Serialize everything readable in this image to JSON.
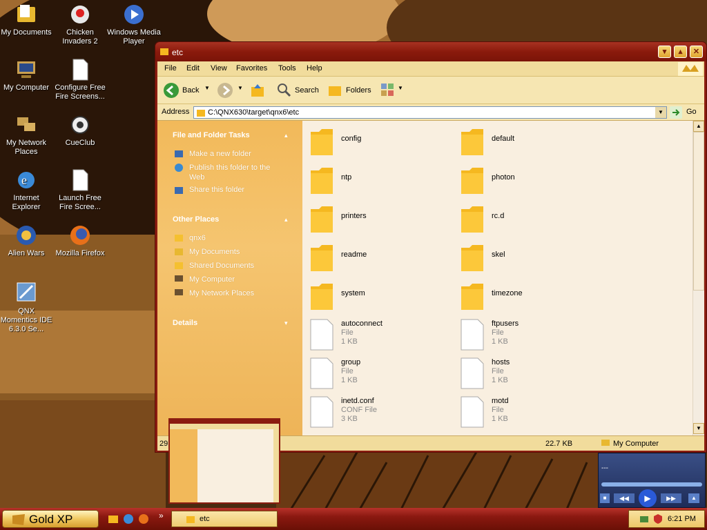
{
  "desktop": {
    "icons": [
      {
        "label": "My Documents"
      },
      {
        "label": "Chicken Invaders 2"
      },
      {
        "label": "Windows Media Player"
      },
      {
        "label": "My Computer"
      },
      {
        "label": "Configure Free Fire Screens..."
      },
      {
        "label": "My Network Places"
      },
      {
        "label": "CueClub"
      },
      {
        "label": "Internet Explorer"
      },
      {
        "label": "Launch Free Fire Scree..."
      },
      {
        "label": "Alien Wars"
      },
      {
        "label": "Mozilla Firefox"
      },
      {
        "label": "QNX Momentics IDE 6.3.0 Se..."
      }
    ]
  },
  "window": {
    "title": "etc",
    "menu": [
      "File",
      "Edit",
      "View",
      "Favorites",
      "Tools",
      "Help"
    ],
    "toolbar": {
      "back": "Back",
      "search": "Search",
      "folders": "Folders"
    },
    "address": {
      "label": "Address",
      "value": "C:\\QNX630\\target\\qnx6\\etc",
      "go": "Go"
    },
    "sidebar": {
      "file_tasks": {
        "title": "File and Folder Tasks",
        "items": [
          "Make a new folder",
          "Publish this folder to the Web",
          "Share this folder"
        ]
      },
      "other_places": {
        "title": "Other Places",
        "items": [
          "qnx6",
          "My Documents",
          "Shared Documents",
          "My Computer",
          "My Network Places"
        ]
      },
      "details": {
        "title": "Details"
      }
    },
    "items": [
      {
        "name": "config",
        "type": "folder"
      },
      {
        "name": "default",
        "type": "folder"
      },
      {
        "name": "ntp",
        "type": "folder"
      },
      {
        "name": "photon",
        "type": "folder"
      },
      {
        "name": "printers",
        "type": "folder"
      },
      {
        "name": "rc.d",
        "type": "folder"
      },
      {
        "name": "readme",
        "type": "folder"
      },
      {
        "name": "skel",
        "type": "folder"
      },
      {
        "name": "system",
        "type": "folder"
      },
      {
        "name": "timezone",
        "type": "folder"
      },
      {
        "name": "autoconnect",
        "type": "file",
        "kind": "File",
        "size": "1 KB"
      },
      {
        "name": "ftpusers",
        "type": "file",
        "kind": "File",
        "size": "1 KB"
      },
      {
        "name": "group",
        "type": "file",
        "kind": "File",
        "size": "1 KB"
      },
      {
        "name": "hosts",
        "type": "file",
        "kind": "File",
        "size": "1 KB"
      },
      {
        "name": "inetd.conf",
        "type": "file",
        "kind": "CONF File",
        "size": "3 KB"
      },
      {
        "name": "motd",
        "type": "file",
        "kind": "File",
        "size": "1 KB"
      }
    ],
    "status": {
      "count": "29",
      "size": "22.7 KB",
      "location": "My Computer"
    }
  },
  "taskbar": {
    "start": "Gold XP",
    "task": "etc",
    "clock": "6:21 PM",
    "chevron": "»"
  },
  "media": {
    "text": "---"
  },
  "colors": {
    "title": "#8b1c10",
    "sidebar": "#f2b95a",
    "folder": "#f5b820"
  }
}
